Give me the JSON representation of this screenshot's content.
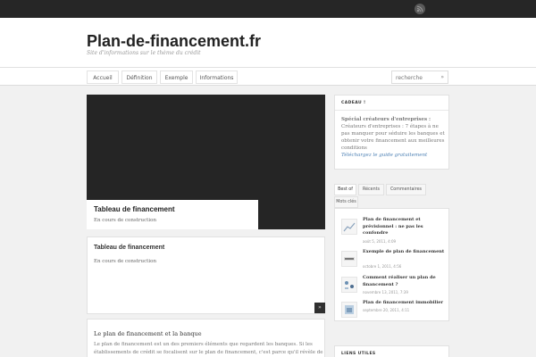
{
  "topbar": {
    "rss_icon": "rss-icon"
  },
  "header": {
    "title": "Plan-de-financement.fr",
    "description": "Site d'informations sur le thème du crédit"
  },
  "nav": {
    "items": [
      {
        "label": "Accueil"
      },
      {
        "label": "Définition"
      },
      {
        "label": "Exemple"
      },
      {
        "label": "Informations"
      }
    ],
    "search": {
      "placeholder": "recherche",
      "button": "»"
    }
  },
  "slider": {
    "caption_title": "Tableau de financement",
    "caption_text": "En cours de construction",
    "next_label": "»"
  },
  "posts": [
    {
      "title": "Tableau de financement",
      "excerpt": "En cours de construction",
      "more_label": "»"
    },
    {
      "title": "Le plan de financement et la banque",
      "lines": [
        "Le plan de financement est un des premiers éléments que regardent les banques. Si les",
        "établissements de crédit se focalisent sur le plan de financement, c'est parce qu'il révèle de"
      ]
    }
  ],
  "widgets": {
    "gift": {
      "heading": "CADEAU !",
      "title": "Spécial créateurs d'entreprises",
      "lines": [
        "Spécial créateurs d'entreprises :",
        "Créateurs d'entreprises : 7 étapes à ne",
        "pas manquer pour séduire les banques et",
        "obtenir votre financement aux meilleures",
        "conditions"
      ],
      "link": "Téléchargez le guide gratuitement"
    },
    "tabs": [
      {
        "label": "Best of",
        "active": true
      },
      {
        "label": "Récents",
        "active": false
      },
      {
        "label": "Commentaires",
        "active": false
      },
      {
        "label": "Mots clés",
        "active": false
      }
    ],
    "popular": [
      {
        "title": "Plan de financement et prévisionnel : ne pas les confondre",
        "date": "août 5, 2011, 4:09"
      },
      {
        "title": "Exemple de plan de financement",
        "date": "octobre 1, 2011, 4:56"
      },
      {
        "title": "Comment réaliser un plan de financement ?",
        "date": "novembre 13, 2011, 7:39"
      },
      {
        "title": "Plan de financement immobilier",
        "date": "septembre 20, 2011, 4:11"
      }
    ],
    "links": {
      "heading": "LIENS UTILES"
    }
  }
}
